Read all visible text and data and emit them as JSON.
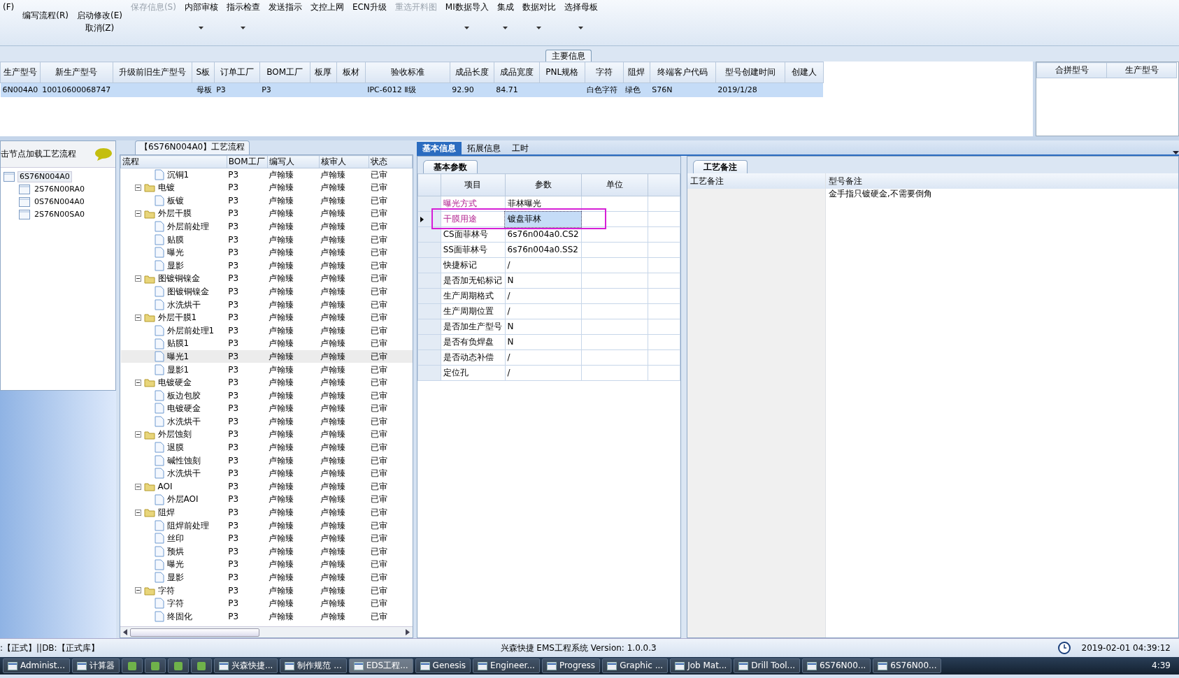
{
  "ribbon": {
    "prefix": "(F)",
    "items": [
      {
        "label": "编写流程(R)",
        "kind": "toggle",
        "disabled": false,
        "dropdown": false
      },
      {
        "label": "启动修改(E)",
        "sublabel": "取消(Z)",
        "kind": "toggle",
        "disabled": false,
        "dropdown": false
      },
      {
        "label": "保存信息(S)",
        "kind": "command",
        "disabled": true,
        "dropdown": false
      },
      {
        "label": "内部审核",
        "kind": "command",
        "disabled": false,
        "dropdown": true
      },
      {
        "label": "指示检查",
        "kind": "command",
        "disabled": false,
        "dropdown": true
      },
      {
        "label": "发送指示",
        "kind": "command",
        "disabled": false,
        "dropdown": false
      },
      {
        "label": "文控上网",
        "kind": "command",
        "disabled": false,
        "dropdown": false
      },
      {
        "label": "ECN升级",
        "kind": "command",
        "disabled": false,
        "dropdown": false
      },
      {
        "label": "重选开料图",
        "kind": "command",
        "disabled": true,
        "dropdown": false
      },
      {
        "label": "MI数据导入",
        "kind": "command",
        "disabled": false,
        "dropdown": true
      },
      {
        "label": "集成",
        "kind": "command",
        "disabled": false,
        "dropdown": true
      },
      {
        "label": "数据对比",
        "kind": "command",
        "disabled": false,
        "dropdown": true
      },
      {
        "label": "选择母板",
        "kind": "command",
        "disabled": false,
        "dropdown": true
      }
    ]
  },
  "group_label": "主要信息",
  "main_table": {
    "columns": [
      "生产型号",
      "新生产型号",
      "升级前旧生产型号",
      "S板",
      "订单工厂",
      "BOM工厂",
      "板厚",
      "板材",
      "验收标准",
      "成品长度",
      "成品宽度",
      "PNL规格",
      "字符",
      "阻焊",
      "终端客户代码",
      "型号创建时间",
      "创建人"
    ],
    "rows": [
      {
        "selected": true,
        "cells": [
          "6N004A0",
          "10010600068747",
          "",
          "母板",
          "P3",
          "P3",
          "",
          "",
          "IPC-6012 Ⅱ级",
          "92.90",
          "84.71",
          "",
          "白色字符",
          "绿色",
          "S76N",
          "2019/1/28",
          ""
        ]
      }
    ]
  },
  "side_table": {
    "columns": [
      "合拼型号",
      "生产型号"
    ]
  },
  "model_panel": {
    "hint": "击节点加载工艺流程",
    "tree": [
      {
        "label": "6S76N004A0",
        "selected": true,
        "children": [
          {
            "label": "2S76N00RA0",
            "selected": false
          },
          {
            "label": "0S76N004A0",
            "selected": false
          },
          {
            "label": "2S76N00SA0",
            "selected": false
          }
        ]
      }
    ]
  },
  "flow_panel": {
    "title": "【6S76N004A0】工艺流程",
    "columns": [
      "流程",
      "BOM工厂",
      "编写人",
      "核审人",
      "状态"
    ],
    "rows": [
      {
        "label": "沉铜1",
        "kind": "step",
        "bom": "P3",
        "writer": "卢翰臻",
        "reviewer": "卢翰臻",
        "status": "已审",
        "selected": false
      },
      {
        "label": "电镀",
        "kind": "group",
        "bom": "P3",
        "writer": "卢翰臻",
        "reviewer": "卢翰臻",
        "status": "已审",
        "selected": false,
        "expanded": true,
        "children": [
          {
            "label": "板镀",
            "kind": "step",
            "bom": "P3",
            "writer": "卢翰臻",
            "reviewer": "卢翰臻",
            "status": "已审",
            "selected": false
          }
        ]
      },
      {
        "label": "外层干膜",
        "kind": "group",
        "bom": "P3",
        "writer": "卢翰臻",
        "reviewer": "卢翰臻",
        "status": "已审",
        "selected": false,
        "expanded": true,
        "children": [
          {
            "label": "外层前处理",
            "kind": "step",
            "bom": "P3",
            "writer": "卢翰臻",
            "reviewer": "卢翰臻",
            "status": "已审",
            "selected": false
          },
          {
            "label": "贴膜",
            "kind": "step",
            "bom": "P3",
            "writer": "卢翰臻",
            "reviewer": "卢翰臻",
            "status": "已审",
            "selected": false
          },
          {
            "label": "曝光",
            "kind": "step",
            "bom": "P3",
            "writer": "卢翰臻",
            "reviewer": "卢翰臻",
            "status": "已审",
            "selected": false
          },
          {
            "label": "显影",
            "kind": "step",
            "bom": "P3",
            "writer": "卢翰臻",
            "reviewer": "卢翰臻",
            "status": "已审",
            "selected": false
          }
        ]
      },
      {
        "label": "图镀铜镍金",
        "kind": "group",
        "bom": "P3",
        "writer": "卢翰臻",
        "reviewer": "卢翰臻",
        "status": "已审",
        "selected": false,
        "expanded": true,
        "children": [
          {
            "label": "图镀铜镍金",
            "kind": "step",
            "bom": "P3",
            "writer": "卢翰臻",
            "reviewer": "卢翰臻",
            "status": "已审",
            "selected": false
          },
          {
            "label": "水洗烘干",
            "kind": "step",
            "bom": "P3",
            "writer": "卢翰臻",
            "reviewer": "卢翰臻",
            "status": "已审",
            "selected": false
          }
        ]
      },
      {
        "label": "外层干膜1",
        "kind": "group",
        "bom": "P3",
        "writer": "卢翰臻",
        "reviewer": "卢翰臻",
        "status": "已审",
        "selected": false,
        "expanded": true,
        "children": [
          {
            "label": "外层前处理1",
            "kind": "step",
            "bom": "P3",
            "writer": "卢翰臻",
            "reviewer": "卢翰臻",
            "status": "已审",
            "selected": false
          },
          {
            "label": "贴膜1",
            "kind": "step",
            "bom": "P3",
            "writer": "卢翰臻",
            "reviewer": "卢翰臻",
            "status": "已审",
            "selected": false
          },
          {
            "label": "曝光1",
            "kind": "step",
            "bom": "P3",
            "writer": "卢翰臻",
            "reviewer": "卢翰臻",
            "status": "已审",
            "selected": true
          },
          {
            "label": "显影1",
            "kind": "step",
            "bom": "P3",
            "writer": "卢翰臻",
            "reviewer": "卢翰臻",
            "status": "已审",
            "selected": false
          }
        ]
      },
      {
        "label": "电镀硬金",
        "kind": "group",
        "bom": "P3",
        "writer": "卢翰臻",
        "reviewer": "卢翰臻",
        "status": "已审",
        "selected": false,
        "expanded": true,
        "children": [
          {
            "label": "板边包胶",
            "kind": "step",
            "bom": "P3",
            "writer": "卢翰臻",
            "reviewer": "卢翰臻",
            "status": "已审",
            "selected": false
          },
          {
            "label": "电镀硬金",
            "kind": "step",
            "bom": "P3",
            "writer": "卢翰臻",
            "reviewer": "卢翰臻",
            "status": "已审",
            "selected": false
          },
          {
            "label": "水洗烘干",
            "kind": "step",
            "bom": "P3",
            "writer": "卢翰臻",
            "reviewer": "卢翰臻",
            "status": "已审",
            "selected": false
          }
        ]
      },
      {
        "label": "外层蚀刻",
        "kind": "group",
        "bom": "P3",
        "writer": "卢翰臻",
        "reviewer": "卢翰臻",
        "status": "已审",
        "selected": false,
        "expanded": true,
        "children": [
          {
            "label": "退膜",
            "kind": "step",
            "bom": "P3",
            "writer": "卢翰臻",
            "reviewer": "卢翰臻",
            "status": "已审",
            "selected": false
          },
          {
            "label": "碱性蚀刻",
            "kind": "step",
            "bom": "P3",
            "writer": "卢翰臻",
            "reviewer": "卢翰臻",
            "status": "已审",
            "selected": false
          },
          {
            "label": "水洗烘干",
            "kind": "step",
            "bom": "P3",
            "writer": "卢翰臻",
            "reviewer": "卢翰臻",
            "status": "已审",
            "selected": false
          }
        ]
      },
      {
        "label": "AOI",
        "kind": "group",
        "bom": "P3",
        "writer": "卢翰臻",
        "reviewer": "卢翰臻",
        "status": "已审",
        "selected": false,
        "expanded": true,
        "children": [
          {
            "label": "外层AOI",
            "kind": "step",
            "bom": "P3",
            "writer": "卢翰臻",
            "reviewer": "卢翰臻",
            "status": "已审",
            "selected": false
          }
        ]
      },
      {
        "label": "阻焊",
        "kind": "group",
        "bom": "P3",
        "writer": "卢翰臻",
        "reviewer": "卢翰臻",
        "status": "已审",
        "selected": false,
        "expanded": true,
        "children": [
          {
            "label": "阻焊前处理",
            "kind": "step",
            "bom": "P3",
            "writer": "卢翰臻",
            "reviewer": "卢翰臻",
            "status": "已审",
            "selected": false
          },
          {
            "label": "丝印",
            "kind": "step",
            "bom": "P3",
            "writer": "卢翰臻",
            "reviewer": "卢翰臻",
            "status": "已审",
            "selected": false
          },
          {
            "label": "预烘",
            "kind": "step",
            "bom": "P3",
            "writer": "卢翰臻",
            "reviewer": "卢翰臻",
            "status": "已审",
            "selected": false
          },
          {
            "label": "曝光",
            "kind": "step",
            "bom": "P3",
            "writer": "卢翰臻",
            "reviewer": "卢翰臻",
            "status": "已审",
            "selected": false
          },
          {
            "label": "显影",
            "kind": "step",
            "bom": "P3",
            "writer": "卢翰臻",
            "reviewer": "卢翰臻",
            "status": "已审",
            "selected": false
          }
        ]
      },
      {
        "label": "字符",
        "kind": "group",
        "bom": "P3",
        "writer": "卢翰臻",
        "reviewer": "卢翰臻",
        "status": "已审",
        "selected": false,
        "expanded": true,
        "children": [
          {
            "label": "字符",
            "kind": "step",
            "bom": "P3",
            "writer": "卢翰臻",
            "reviewer": "卢翰臻",
            "status": "已审",
            "selected": false
          },
          {
            "label": "终固化",
            "kind": "step",
            "bom": "P3",
            "writer": "卢翰臻",
            "reviewer": "卢翰臻",
            "status": "已审",
            "selected": false
          }
        ]
      }
    ]
  },
  "tabs": [
    {
      "label": "基本信息",
      "selected": true
    },
    {
      "label": "拓展信息",
      "selected": false
    },
    {
      "label": "工时",
      "selected": false
    }
  ],
  "param_tab": "基本参数",
  "param_table": {
    "columns": [
      "项目",
      "参数",
      "单位"
    ],
    "rows": [
      {
        "item": "曝光方式",
        "value": "菲林曝光",
        "emphasized": true,
        "selected": false,
        "outlined": false
      },
      {
        "item": "干膜用途",
        "value": "镀盘菲林",
        "emphasized": true,
        "selected": true,
        "outlined": true
      },
      {
        "item": "CS面菲林号",
        "value": "6s76n004a0.CS2",
        "emphasized": false,
        "selected": false,
        "outlined": false
      },
      {
        "item": "SS面菲林号",
        "value": "6s76n004a0.SS2",
        "emphasized": false,
        "selected": false,
        "outlined": false
      },
      {
        "item": "快捷标记",
        "value": "/",
        "emphasized": false,
        "selected": false,
        "outlined": false
      },
      {
        "item": "是否加无铅标记",
        "value": "N",
        "emphasized": false,
        "selected": false,
        "outlined": false
      },
      {
        "item": "生产周期格式",
        "value": "/",
        "emphasized": false,
        "selected": false,
        "outlined": false
      },
      {
        "item": "生产周期位置",
        "value": "/",
        "emphasized": false,
        "selected": false,
        "outlined": false
      },
      {
        "item": "是否加生产型号",
        "value": "N",
        "emphasized": false,
        "selected": false,
        "outlined": false
      },
      {
        "item": "是否有负焊盘",
        "value": "N",
        "emphasized": false,
        "selected": false,
        "outlined": false
      },
      {
        "item": "是否动态补偿",
        "value": "/",
        "emphasized": false,
        "selected": false,
        "outlined": false
      },
      {
        "item": "定位孔",
        "value": "/",
        "emphasized": false,
        "selected": false,
        "outlined": false
      }
    ]
  },
  "note_tab": "工艺备注",
  "notes": {
    "columns": [
      "工艺备注",
      "型号备注"
    ],
    "model_note": "金手指只镀硬金,不需要倒角"
  },
  "status_bar": {
    "left": ":【正式】||DB:【正式库】",
    "center": "兴森快捷 EMS工程系统 Version: 1.0.0.3",
    "time": "2019-02-01 04:39:12"
  },
  "taskbar": {
    "items": [
      {
        "label": "Administ...",
        "selected": false
      },
      {
        "label": "计算器",
        "selected": false
      },
      {
        "kind": "icon",
        "selected": false
      },
      {
        "kind": "icon",
        "selected": false
      },
      {
        "kind": "icon",
        "selected": false
      },
      {
        "kind": "icon",
        "selected": false
      },
      {
        "label": "兴森快捷...",
        "selected": false
      },
      {
        "label": "制作规范 ...",
        "selected": false
      },
      {
        "label": "EDS工程...",
        "selected": true
      },
      {
        "label": "Genesis",
        "selected": false
      },
      {
        "label": "Engineer...",
        "selected": false
      },
      {
        "label": "Progress",
        "selected": false
      },
      {
        "label": "Graphic ...",
        "selected": false
      },
      {
        "label": "Job Mat...",
        "selected": false
      },
      {
        "label": "Drill Tool...",
        "selected": false
      },
      {
        "label": "6S76N00...",
        "selected": false
      },
      {
        "label": "6S76N00...",
        "selected": false
      }
    ],
    "clock": "4:39"
  }
}
